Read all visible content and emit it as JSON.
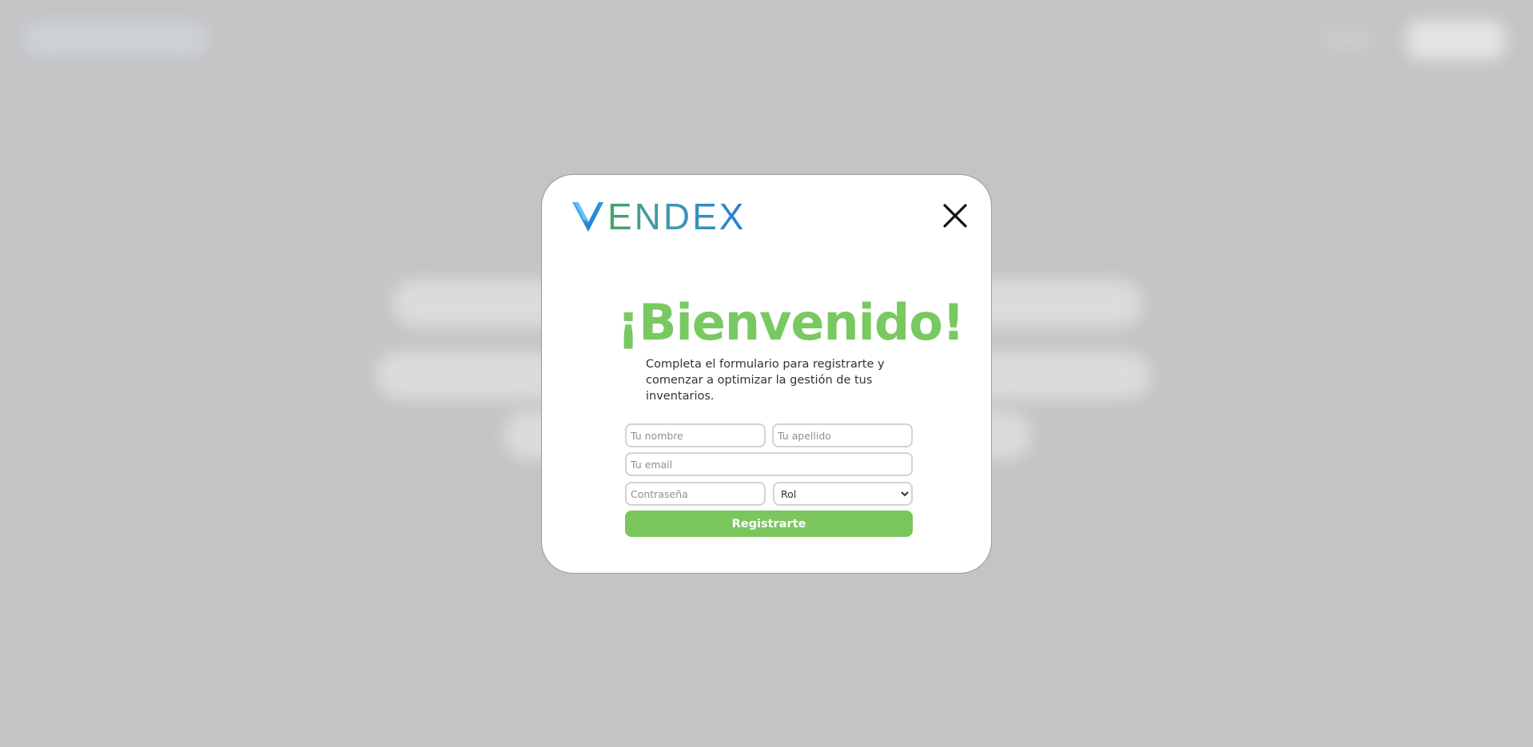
{
  "brand": {
    "name": "ENDEX",
    "gradient_start": "#48a26b",
    "gradient_end": "#2a7fd0"
  },
  "modal": {
    "title": "¡Bienvenido!",
    "subtitle": "Completa el formulario para registrarte y comenzar a optimizar la gestión de tus inventarios.",
    "close_icon": "close-icon"
  },
  "form": {
    "nombre_placeholder": "Tu nombre",
    "apellido_placeholder": "Tu apellido",
    "email_placeholder": "Tu email",
    "password_placeholder": "Contraseña",
    "rol_selected": "Rol",
    "submit_label": "Registrarte"
  },
  "colors": {
    "accent_green": "#79c961",
    "button_green": "#7ac65d",
    "overlay_gray": "#c3c4c6"
  }
}
